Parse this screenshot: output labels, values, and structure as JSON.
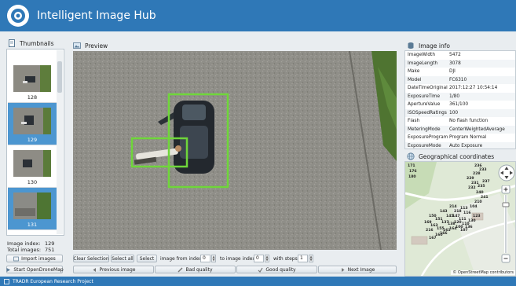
{
  "app": {
    "title": "Intelligent Image Hub"
  },
  "thumbnails": {
    "header": "Thumbnails",
    "items": [
      {
        "label": "128",
        "selected": false
      },
      {
        "label": "129",
        "selected": true
      },
      {
        "label": "130",
        "selected": false
      },
      {
        "label": "131",
        "selected": true
      }
    ],
    "image_index_label": "Image index:",
    "image_index_value": "129",
    "total_images_label": "Total images:",
    "total_images_value": "751",
    "import_button": "Import images",
    "odm_button": "Start OpenDroneMap"
  },
  "preview": {
    "header": "Preview",
    "clear_selection": "Clear Selection",
    "select_all": "Select all",
    "select": "Select",
    "from_index_label": "image from index",
    "from_index_value": "0",
    "to_index_label": "to image index",
    "to_index_value": "0",
    "steps_label": "with steps",
    "steps_value": "1",
    "prev_button": "Previous image",
    "bad_button": "Bad quality",
    "good_button": "Good quality",
    "next_button": "Next Image"
  },
  "image_info": {
    "header": "Image info",
    "rows": [
      {
        "key": "ImageWidth",
        "value": "5472"
      },
      {
        "key": "ImageLength",
        "value": "3078"
      },
      {
        "key": "Make",
        "value": "DJI"
      },
      {
        "key": "Model",
        "value": "FC6310"
      },
      {
        "key": "DateTimeOriginal",
        "value": "2017:12:27 10:54:14"
      },
      {
        "key": "ExposureTime",
        "value": "1/80"
      },
      {
        "key": "ApertureValue",
        "value": "361/100"
      },
      {
        "key": "ISOSpeedRatings",
        "value": "100"
      },
      {
        "key": "Flash",
        "value": "No flash function"
      },
      {
        "key": "MeteringMode",
        "value": "CenterWeightedAverage"
      },
      {
        "key": "ExposureProgram",
        "value": "Program Normal"
      },
      {
        "key": "ExposureMode",
        "value": "Auto Exposure"
      }
    ]
  },
  "geo": {
    "header": "Geographical coordinates",
    "attribution": "© OpenStreetMap contributors",
    "markers": [
      "171",
      "176",
      "180",
      "236",
      "233",
      "228",
      "229",
      "231",
      "235",
      "237",
      "232",
      "240",
      "241",
      "214",
      "218",
      "143",
      "145",
      "147",
      "113",
      "116",
      "150",
      "151",
      "137",
      "138",
      "120",
      "111",
      "110",
      "169",
      "163",
      "155",
      "161",
      "164",
      "160",
      "167",
      "166",
      "100",
      "107",
      "136",
      "130",
      "123",
      "104",
      "210",
      "216"
    ]
  },
  "footer": {
    "text": "TRADR European Research Project"
  },
  "colors": {
    "accent": "#2f78b7",
    "selection": "#4c96d0",
    "detection_box": "#6fd63a"
  }
}
